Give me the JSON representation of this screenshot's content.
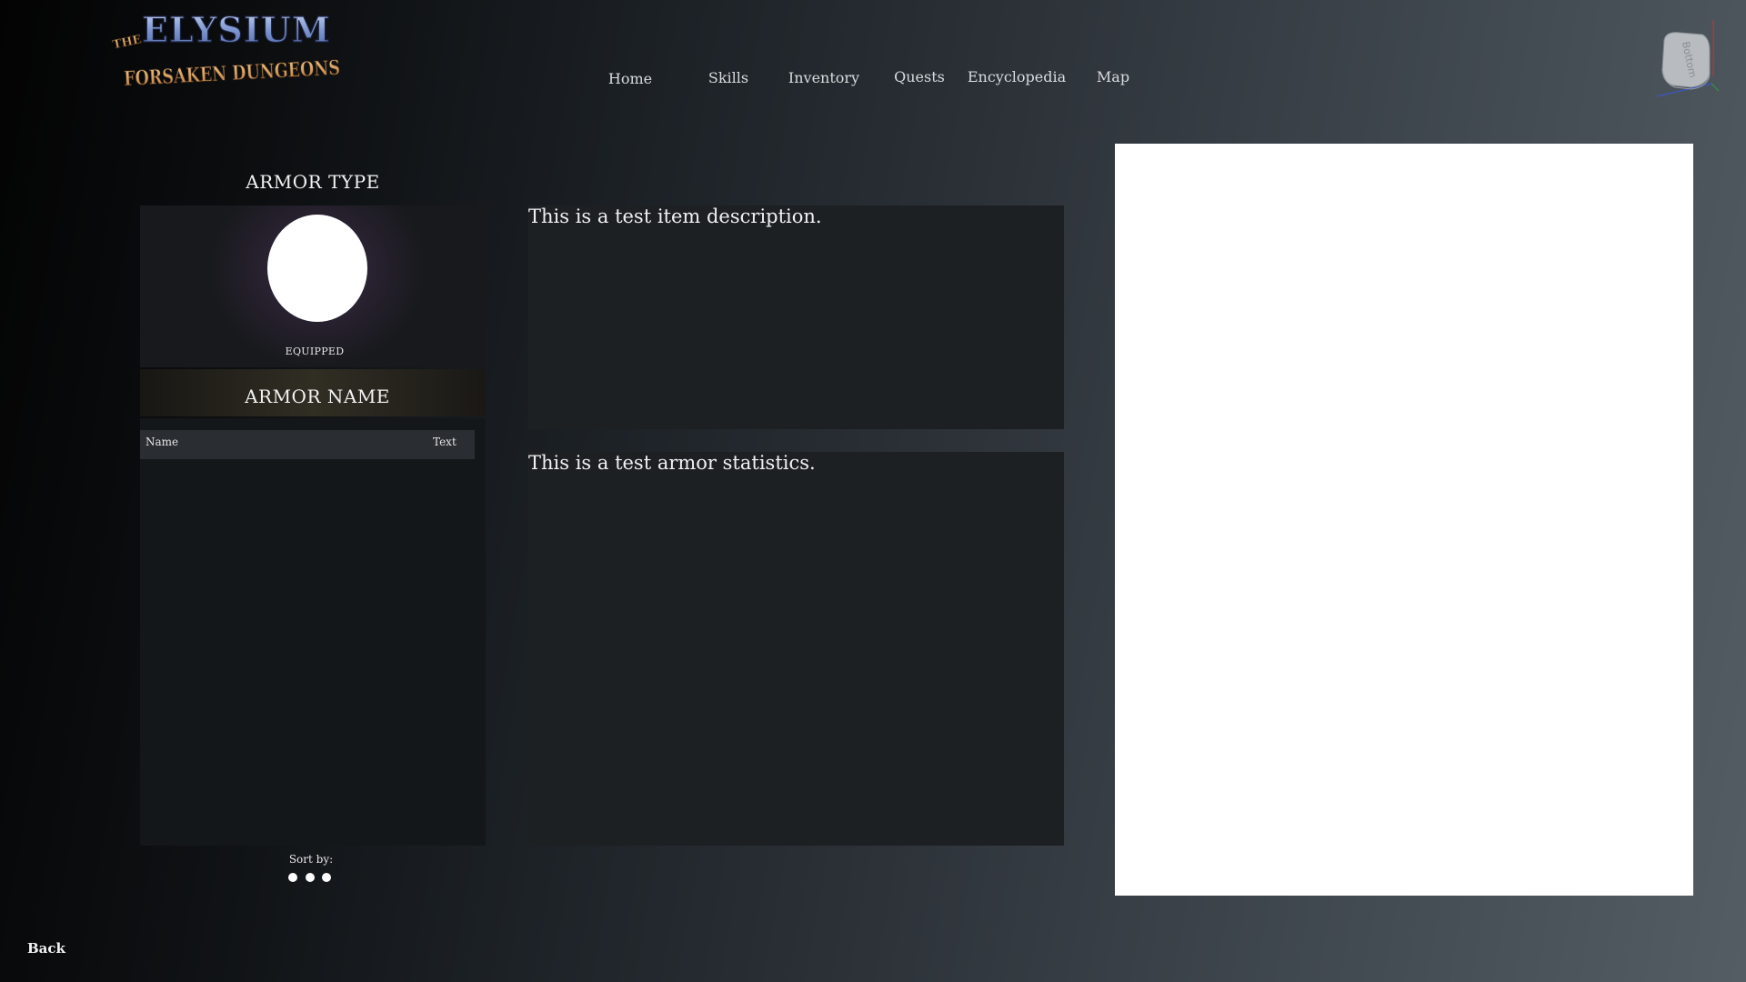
{
  "logo": {
    "the": "THE",
    "title": "ELYSIUM",
    "subtitle": "FORSAKEN DUNGEONS"
  },
  "nav": {
    "items": [
      {
        "label": "Home"
      },
      {
        "label": "Skills"
      },
      {
        "label": "Inventory"
      },
      {
        "label": "Quests"
      },
      {
        "label": "Encyclopedia"
      },
      {
        "label": "Map"
      }
    ]
  },
  "view_cube": {
    "face_label": "Bottom"
  },
  "armor": {
    "type_title": "ARMOR TYPE",
    "equipped_label": "EQUIPPED",
    "name": "ARMOR NAME"
  },
  "list": {
    "columns": [
      "Name",
      "Text"
    ],
    "sort_label": "Sort by:"
  },
  "details": {
    "description": "This is a test item description.",
    "statistics": "This is a test armor statistics."
  },
  "back_label": "Back",
  "colors": {
    "preview_background": "#ffffff",
    "logo_title": "#8fa7da",
    "logo_subtitle": "#d19a55"
  }
}
